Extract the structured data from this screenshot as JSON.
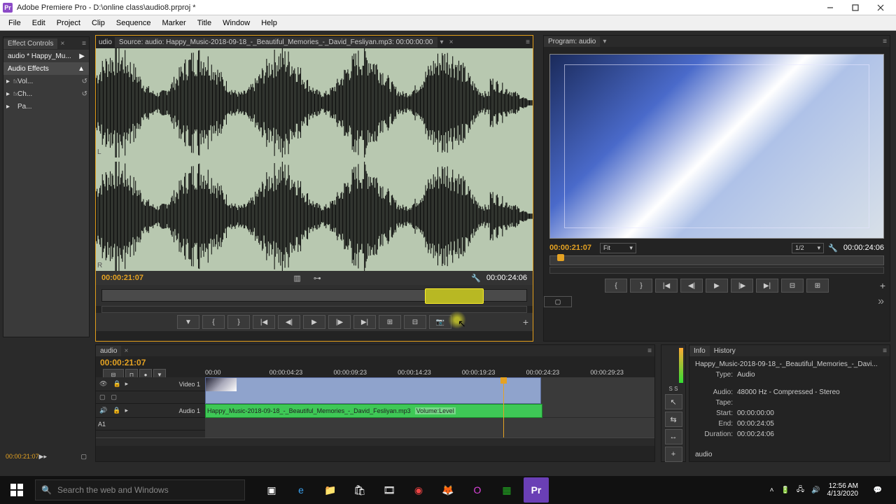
{
  "titlebar": {
    "title": "Adobe Premiere Pro - D:\\online class\\audio8.prproj *"
  },
  "menu": [
    "File",
    "Edit",
    "Project",
    "Clip",
    "Sequence",
    "Marker",
    "Title",
    "Window",
    "Help"
  ],
  "effect_controls": {
    "tab": "Effect Controls",
    "clip": "audio * Happy_Mu...",
    "section": "Audio Effects",
    "rows": [
      {
        "label": "Vol..."
      },
      {
        "label": "Ch..."
      },
      {
        "label": "Pa..."
      }
    ]
  },
  "source": {
    "aud_label": "udio",
    "tab": "Source: audio: Happy_Music-2018-09-18_-_Beautiful_Memories_-_David_Fesliyan.mp3: 00:00:00:00",
    "current": "00:00:21:07",
    "duration": "00:00:24:06",
    "channels": {
      "l": "L",
      "r": "R"
    }
  },
  "program": {
    "title": "Program: audio",
    "current": "00:00:21:07",
    "duration": "00:00:24:06",
    "fit": "Fit",
    "res": "1/2"
  },
  "timeline": {
    "tab": "audio",
    "current": "00:00:21:07",
    "ruler": [
      "00:00",
      "00:00:04:23",
      "00:00:09:23",
      "00:00:14:23",
      "00:00:19:23",
      "00:00:24:23",
      "00:00:29:23"
    ],
    "video_track": "Video 1",
    "audio_track": "Audio 1",
    "a1": "A1",
    "clip_name": "Happy_Music-2018-09-18_-_Beautiful_Memories_-_David_Fesliyan.mp3",
    "level": "Volume:Level"
  },
  "info": {
    "tabs": [
      "Info",
      "History"
    ],
    "name": "Happy_Music-2018-09-18_-_Beautiful_Memories_-_Davi...",
    "type_k": "Type:",
    "type_v": "Audio",
    "audio_k": "Audio:",
    "audio_v": "48000 Hz - Compressed - Stereo",
    "tape_k": "Tape:",
    "start_k": "Start:",
    "start_v": "00:00:00:00",
    "end_k": "End:",
    "end_v": "00:00:24:05",
    "dur_k": "Duration:",
    "dur_v": "00:00:24:06",
    "seq": "audio"
  },
  "project": {
    "tc": "00:00:21:07"
  },
  "taskbar": {
    "search_placeholder": "Search the web and Windows",
    "time": "12:56 AM",
    "date": "4/13/2020"
  }
}
